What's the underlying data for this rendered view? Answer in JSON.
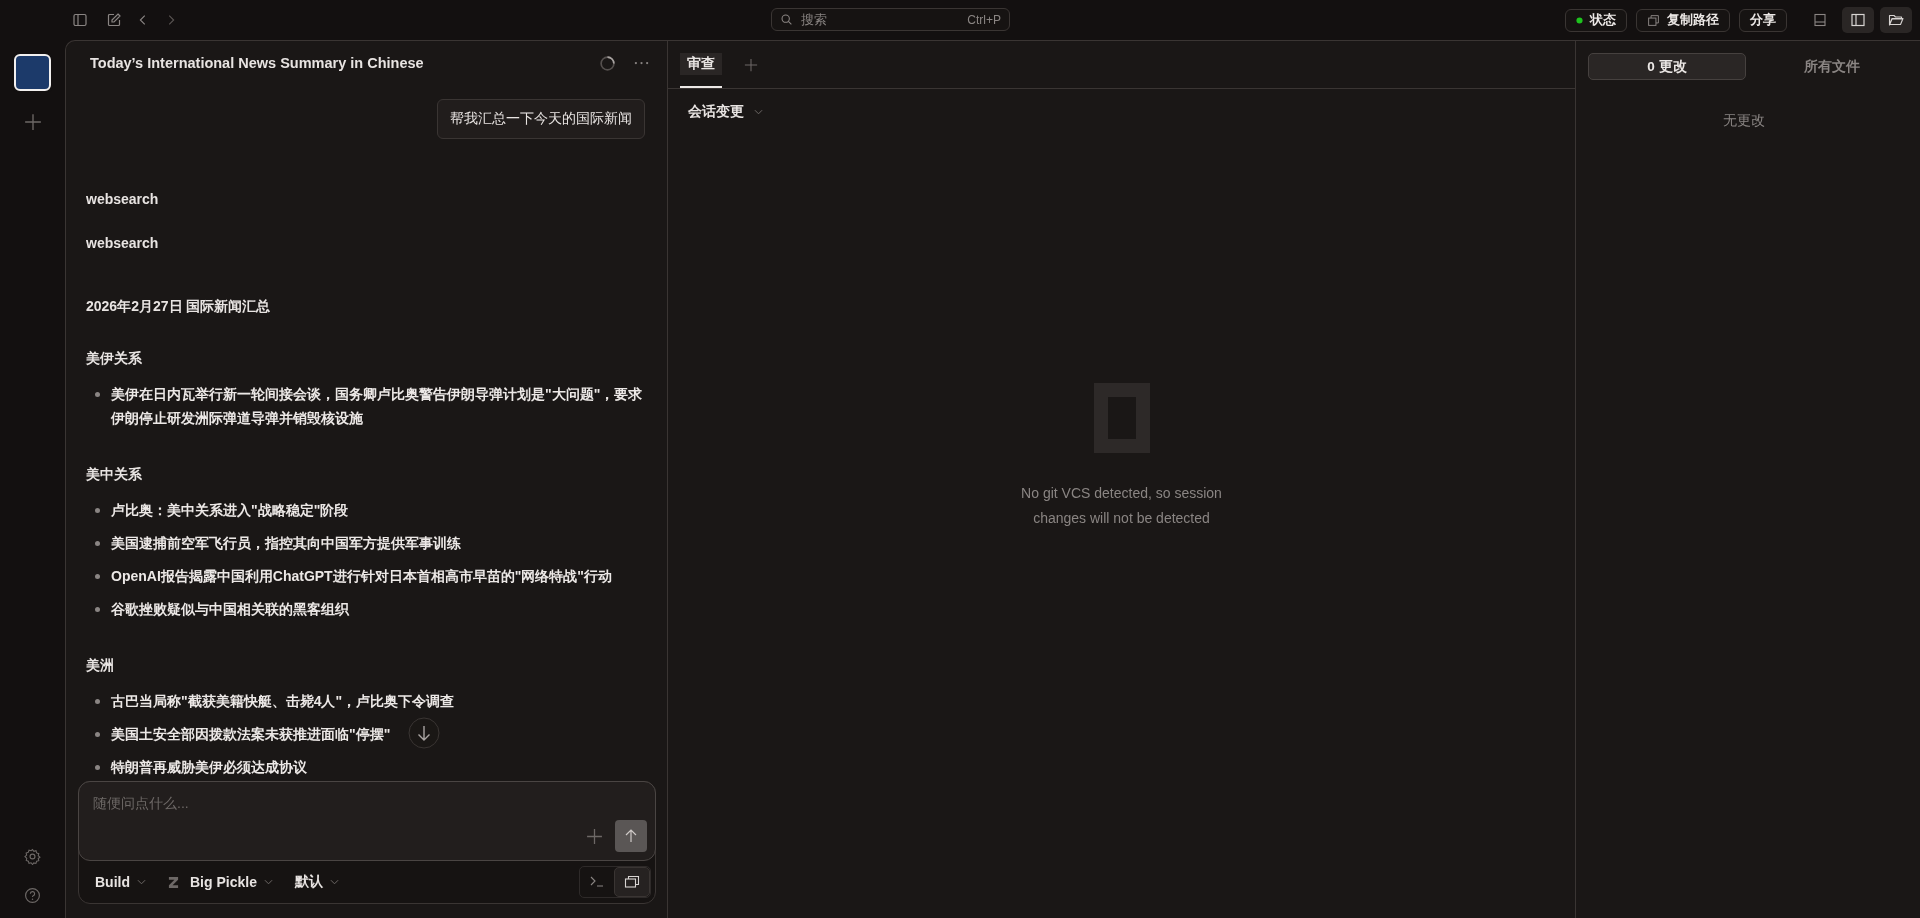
{
  "topbar": {
    "search": {
      "placeholder": "搜索",
      "shortcut": "Ctrl+P"
    },
    "buttons": [
      {
        "label": "状态",
        "kind": "status"
      },
      {
        "label": "复制路径",
        "kind": "copy"
      },
      {
        "label": "分享",
        "kind": "plain"
      }
    ],
    "toggles": [
      {
        "kind": "terminal",
        "selected": false
      },
      {
        "kind": "sidebar",
        "selected": true
      },
      {
        "kind": "folder",
        "selected": true
      }
    ]
  },
  "chat": {
    "title": "Today’s International News Summary in Chinese",
    "user_message": "帮我汇总一下今天的国际新闻",
    "blocks": [
      {
        "kind": "tool",
        "text": "websearch"
      },
      {
        "kind": "tool",
        "text": "websearch"
      },
      {
        "kind": "heading",
        "text": "2026年2月27日 国际新闻汇总"
      },
      {
        "kind": "section",
        "text": "美伊关系"
      },
      {
        "kind": "bullet",
        "text": "美伊在日内瓦举行新一轮间接会谈，国务卿卢比奥警告伊朗导弹计划是\"大问题\"，要求伊朗停止研发洲际弹道导弹并销毁核设施"
      },
      {
        "kind": "section",
        "text": "美中关系"
      },
      {
        "kind": "bullet",
        "text": "卢比奥：美中关系进入\"战略稳定\"阶段"
      },
      {
        "kind": "bullet",
        "text": "美国逮捕前空军飞行员，指控其向中国军方提供军事训练"
      },
      {
        "kind": "bullet",
        "text": "OpenAI报告揭露中国利用ChatGPT进行针对日本首相高市早苗的\"网络特战\"行动"
      },
      {
        "kind": "bullet",
        "text": "谷歌挫败疑似与中国相关联的黑客组织"
      },
      {
        "kind": "section",
        "text": "美洲"
      },
      {
        "kind": "bullet",
        "text": "古巴当局称\"截获美籍快艇、击毙4人\"，卢比奥下令调查"
      },
      {
        "kind": "bullet",
        "text": "美国土安全部因拨款法案未获推进面临\"停摆\""
      },
      {
        "kind": "bullet",
        "text": "特朗普再威胁美伊必须达成协议"
      }
    ],
    "composer": {
      "placeholder": "随便问点什么...",
      "options": [
        {
          "label": "Build",
          "kind": "plain"
        },
        {
          "label": "Big Pickle",
          "kind": "model"
        },
        {
          "label": "默认",
          "kind": "plain"
        }
      ],
      "modes": [
        {
          "kind": "terminal",
          "selected": false
        },
        {
          "kind": "chat",
          "selected": true
        }
      ]
    }
  },
  "review": {
    "tabs": [
      {
        "label": "审查",
        "selected": true
      }
    ],
    "dropdown": "会话变更",
    "empty_message": "No git VCS detected, so session changes will not be detected"
  },
  "files": {
    "tabs": [
      {
        "label": "0 更改",
        "selected": true
      },
      {
        "label": "所有文件",
        "selected": false
      }
    ],
    "empty_message": "无更改"
  }
}
